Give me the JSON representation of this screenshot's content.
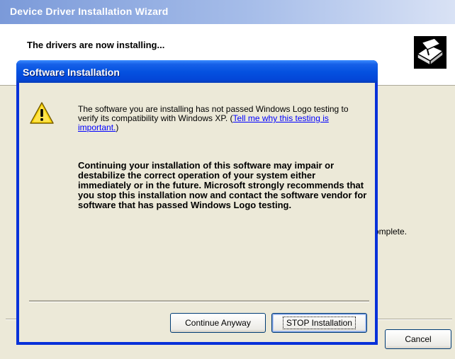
{
  "wizard": {
    "title": "Device Driver Installation Wizard",
    "heading": "The drivers are now installing...",
    "complete_fragment": "omplete.",
    "cancel_label": "Cancel",
    "icon": "hardware-install-icon"
  },
  "dialog": {
    "title": "Software Installation",
    "icon": "warning-icon",
    "message_part1": "The software you are installing has not passed Windows Logo testing to verify its compatibility with Windows XP. (",
    "link_text": "Tell me why this testing is important.",
    "message_part1_end": ")",
    "message2": "Continuing your installation of this software may impair or destabilize the correct operation of your system either immediately or in the future. Microsoft strongly recommends that you stop this installation now and contact the software vendor for software that has passed Windows Logo testing.",
    "continue_label": "Continue Anyway",
    "stop_label": "STOP Installation"
  },
  "colors": {
    "titlebar_blue": "#0552e0",
    "window_face": "#ece9d8",
    "warning_yellow": "#ffd700"
  }
}
